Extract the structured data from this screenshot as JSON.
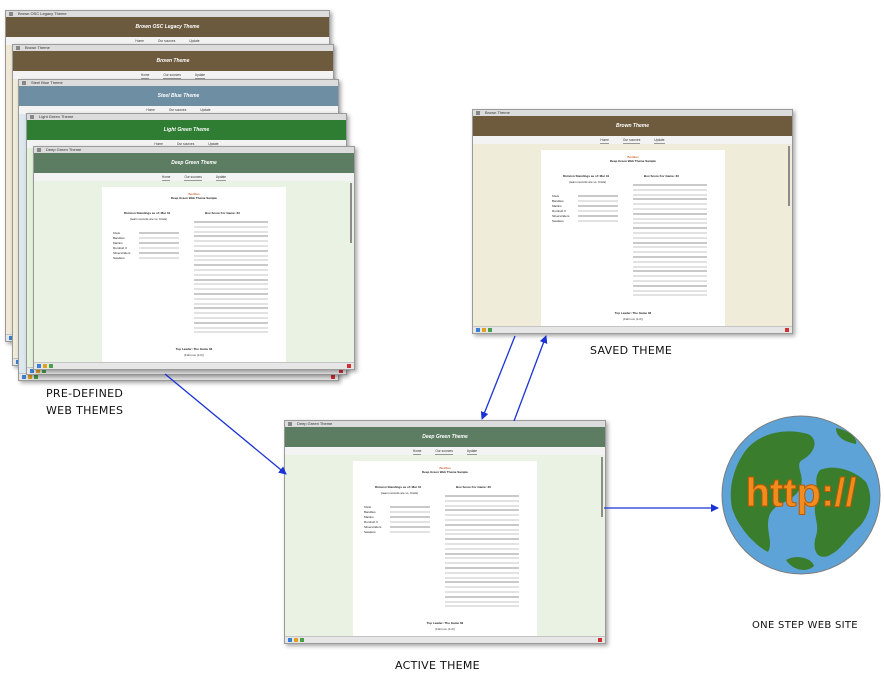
{
  "stack": [
    {
      "tab": "Brown OSC Legacy Theme",
      "title": "Brown OSC Legacy Theme",
      "header_color": "#6b5a3e",
      "bg_color": "#efe9d6",
      "nav": [
        "Home",
        "Our sources",
        "Update"
      ]
    },
    {
      "tab": "Brown Theme",
      "title": "Brown Theme",
      "header_color": "#6e5a3c",
      "bg_color": "#efecd9",
      "nav": [
        "Home",
        "Our sources",
        "Update"
      ]
    },
    {
      "tab": "Steel Blue Theme",
      "title": "Steel Blue Theme",
      "header_color": "#6e8ea3",
      "bg_color": "#dde7ee",
      "nav": [
        "Home",
        "Our sources",
        "Update"
      ]
    },
    {
      "tab": "Light Green Theme",
      "title": "Light Green Theme",
      "header_color": "#2e7d32",
      "bg_color": "#e4f2dc",
      "nav": [
        "Home",
        "Our sources",
        "Update"
      ]
    },
    {
      "tab": "Deep Green Theme",
      "title": "Deep Green Theme",
      "header_color": "#5d7d63",
      "bg_color": "#eaf3e3",
      "nav": [
        "Home",
        "Our sources",
        "Update"
      ]
    }
  ],
  "saved_window": {
    "tab": "Brown Theme",
    "title": "Brown Theme",
    "header_color": "#6e5a3c",
    "bg_color": "#efecd9",
    "nav": [
      "Home",
      "Our sources",
      "Update"
    ]
  },
  "active_window": {
    "tab": "Deep Green Theme",
    "title": "Deep Green Theme",
    "header_color": "#5d7d63",
    "bg_color": "#eaf3e3",
    "nav": [
      "Home",
      "Our sources",
      "Update"
    ]
  },
  "sample_page": {
    "page_title": "BoxMan",
    "subtitle": "Deep Green Web Theme Sample",
    "standings_title": "Division Standings as of: Mar 31",
    "standings_note": "(team records are vs. Kiwis)",
    "standings_teams": [
      "Kiwis",
      "Banditos",
      "Marlins",
      "Rumbolt II",
      "Silverstriders",
      "Swatters"
    ],
    "box_title": "Box Score For Game: 33",
    "leader_title": "Top Leader: The Game 33",
    "leader_name": "(Fabrous (4-0))"
  },
  "labels": {
    "predefined": [
      "PRE-DEFINED",
      "WEB THEMES"
    ],
    "saved": "SAVED THEME",
    "active": "ACTIVE THEME",
    "one_step": "ONE STEP WEB SITE"
  },
  "globe": {
    "text": "http://",
    "ocean_color": "#5ea3d8",
    "land_color": "#3a7d2c",
    "text_color": "#f28c1e"
  },
  "arrow_color": "#1a33d6"
}
